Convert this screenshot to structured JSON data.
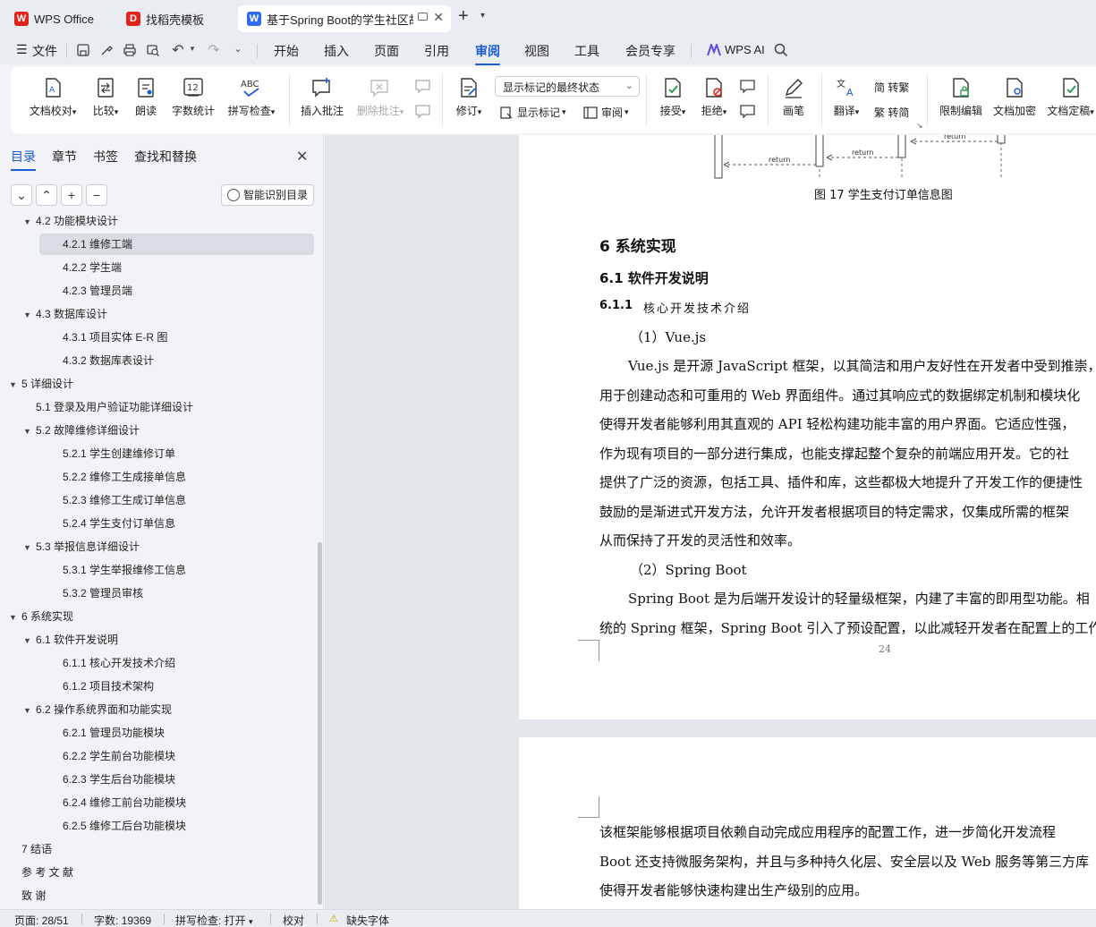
{
  "tabs": [
    {
      "label": "WPS Office",
      "icon": "wps-logo-icon",
      "color": "#e2231a"
    },
    {
      "label": "找稻壳模板",
      "icon": "docer-logo-icon",
      "color": "#e2231a"
    },
    {
      "label": "基于Spring Boot的学生社区故",
      "icon": "writer-logo-icon",
      "color": "#2f6bf1"
    }
  ],
  "new_tab_label": "+",
  "menu": {
    "file": "文件",
    "items": [
      "开始",
      "插入",
      "页面",
      "引用",
      "审阅",
      "视图",
      "工具",
      "会员专享"
    ],
    "active": "审阅",
    "wps_ai": "WPS AI"
  },
  "ribbon": {
    "buttons": [
      "文档校对",
      "比较",
      "朗读",
      "字数统计",
      "拼写检查",
      "插入批注",
      "删除批注",
      "修订",
      "接受",
      "拒绝",
      "画笔",
      "翻译",
      "限制编辑",
      "文档加密",
      "文档定稿"
    ],
    "display_select": "显示标记的最终状态",
    "show_markup": "显示标记",
    "review": "审阅",
    "to_traditional": "简 转繁",
    "to_simplified": "繁 转简",
    "word_count_icon": "12"
  },
  "nav": {
    "tabs": [
      "目录",
      "章节",
      "书签",
      "查找和替换"
    ],
    "active_tab": "目录",
    "smart_button": "智能识别目录",
    "toc": [
      {
        "label": "4.2   功能模块设计",
        "level": 2,
        "tri": true
      },
      {
        "label": "4.2.1   维修工端",
        "level": 3,
        "selected": true
      },
      {
        "label": "4.2.2   学生端",
        "level": 3
      },
      {
        "label": "4.2.3   管理员端",
        "level": 3
      },
      {
        "label": "4.3   数据库设计",
        "level": 2,
        "tri": true
      },
      {
        "label": "4.3.1   项目实体 E-R 图",
        "level": 3
      },
      {
        "label": "4.3.2   数据库表设计",
        "level": 3
      },
      {
        "label": "5   详细设计",
        "level": 1,
        "tri": true
      },
      {
        "label": "5.1   登录及用户验证功能详细设计",
        "level": 2
      },
      {
        "label": "5.2   故障维修详细设计",
        "level": 2,
        "tri": true
      },
      {
        "label": "5.2.1   学生创建维修订单",
        "level": 3
      },
      {
        "label": "5.2.2   维修工生成接单信息",
        "level": 3
      },
      {
        "label": "5.2.3   维修工生成订单信息",
        "level": 3
      },
      {
        "label": "5.2.4   学生支付订单信息",
        "level": 3
      },
      {
        "label": "5.3   举报信息详细设计",
        "level": 2,
        "tri": true
      },
      {
        "label": "5.3.1   学生举报维修工信息",
        "level": 3
      },
      {
        "label": "5.3.2   管理员审核",
        "level": 3
      },
      {
        "label": "6   系统实现",
        "level": 1,
        "tri": true
      },
      {
        "label": "6.1   软件开发说明",
        "level": 2,
        "tri": true
      },
      {
        "label": "6.1.1   核心开发技术介绍",
        "level": 3
      },
      {
        "label": "6.1.2   项目技术架构",
        "level": 3
      },
      {
        "label": "6.2   操作系统界面和功能实现",
        "level": 2,
        "tri": true
      },
      {
        "label": "6.2.1   管理员功能模块",
        "level": 3
      },
      {
        "label": "6.2.2   学生前台功能模块",
        "level": 3
      },
      {
        "label": "6.2.3   学生后台功能模块",
        "level": 3
      },
      {
        "label": "6.2.4   维修工前台功能模块",
        "level": 3
      },
      {
        "label": "6.2.5   维修工后台功能模块",
        "level": 3
      },
      {
        "label": "7   结语",
        "level": 1
      },
      {
        "label": "参   考   文   献",
        "level": 1
      },
      {
        "label": "致             谢",
        "level": 1
      }
    ]
  },
  "document": {
    "diagram_labels": [
      "return",
      "return",
      "return"
    ],
    "figure_caption": "图 17  学生支付订单信息图",
    "h1": "6    系统实现",
    "h2": "6.1    软件开发说明",
    "h3_num": "6.1.1",
    "h3_text": "核心开发技术介绍",
    "item1": "（1）Vue.js",
    "paragraph1": [
      "Vue.js 是开源 JavaScript 框架，以其简洁和用户友好性在开发者中受到推崇，",
      "用于创建动态和可重用的 Web 界面组件。通过其响应式的数据绑定机制和模块化",
      "使得开发者能够利用其直观的 API 轻松构建功能丰富的用户界面。它适应性强，",
      "作为现有项目的一部分进行集成，也能支撑起整个复杂的前端应用开发。它的社",
      "提供了广泛的资源，包括工具、插件和库，这些都极大地提升了开发工作的便捷性",
      "鼓励的是渐进式开发方法，允许开发者根据项目的特定需求，仅集成所需的框架",
      "从而保持了开发的灵活性和效率。"
    ],
    "item2": "（2）Spring Boot",
    "paragraph2": [
      "Spring Boot 是为后端开发设计的轻量级框架，内建了丰富的即用型功能。相",
      "统的 Spring 框架，Spring Boot 引入了预设配置，以此减轻开发者在配置上的工作"
    ],
    "page_number": "24",
    "page2": [
      "该框架能够根据项目依赖自动完成应用程序的配置工作，进一步简化开发流程",
      "Boot 还支持微服务架构，并且与多种持久化层、安全层以及 Web 服务等第三方库",
      "使得开发者能够快速构建出生产级别的应用。"
    ]
  },
  "status": {
    "page": "页面: 28/51",
    "words": "字数: 19369",
    "spell": "拼写检查: 打开",
    "proof": "校对",
    "missing_font": "缺失字体"
  }
}
